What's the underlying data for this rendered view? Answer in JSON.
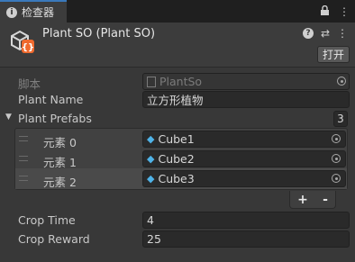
{
  "tab": {
    "title": "检查器"
  },
  "header": {
    "title": "Plant SO (Plant SO)",
    "open_button": "打开"
  },
  "fields": {
    "script": {
      "label": "脚本",
      "value": "PlantSo"
    },
    "plant_name": {
      "label": "Plant Name",
      "value": "立方形植物"
    },
    "plant_prefabs": {
      "label": "Plant Prefabs",
      "count": "3",
      "elements": [
        {
          "label": "元素 0",
          "value": "Cube1"
        },
        {
          "label": "元素 1",
          "value": "Cube2"
        },
        {
          "label": "元素 2",
          "value": "Cube3"
        }
      ],
      "add_label": "+",
      "remove_label": "-"
    },
    "crop_time": {
      "label": "Crop Time",
      "value": "4"
    },
    "crop_reward": {
      "label": "Crop Reward",
      "value": "25"
    }
  },
  "icons": {
    "tab": "info-icon",
    "header_asset": "scriptable-object-icon",
    "help": "help-icon",
    "settings": "settings-sliders-icon",
    "more": "more-vertical-icon",
    "lock": "lock-icon"
  },
  "colors": {
    "accent": "#3a79bb",
    "cube_icon": "#4fb3e8"
  }
}
